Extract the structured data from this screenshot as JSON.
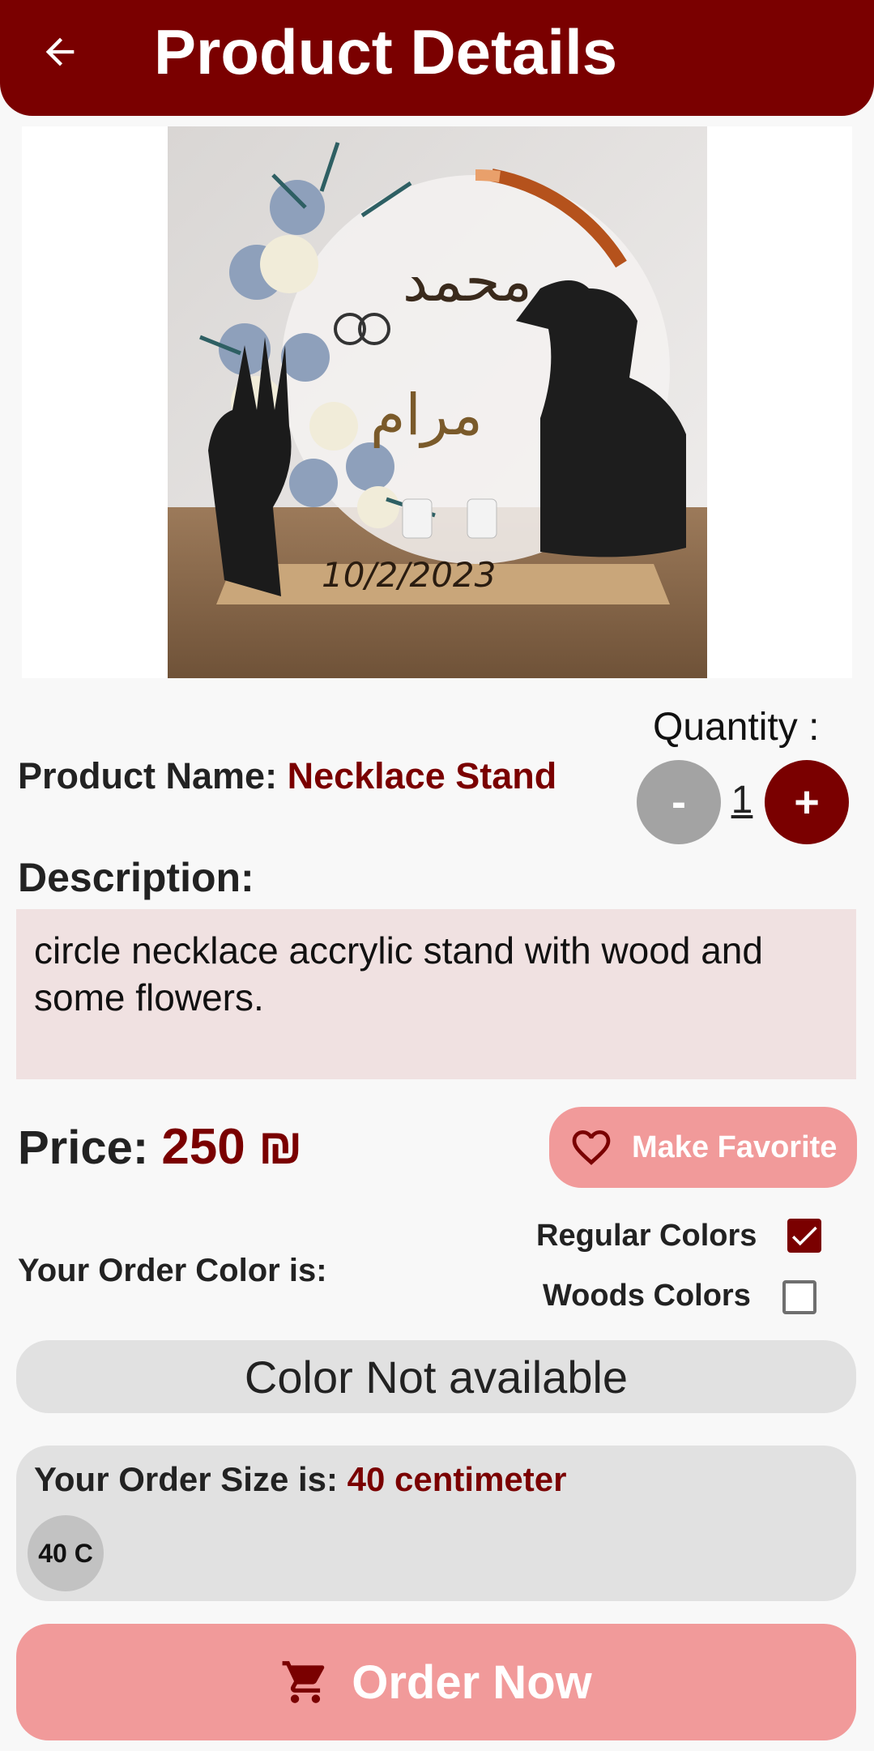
{
  "appbar": {
    "title": "Product Details",
    "back_icon": "arrow-left-icon"
  },
  "product": {
    "name_label": "Product Name:",
    "name": "Necklace Stand",
    "description_label": "Description:",
    "description": "circle necklace accrylic stand with wood and some flowers.",
    "price_label": "Price:",
    "price": "250",
    "currency": "₪",
    "photo_text": {
      "date": "10/2/2023",
      "names_top": "محمد",
      "names_bottom": "مرام"
    }
  },
  "quantity": {
    "label": "Quantity :",
    "minus": "-",
    "value": "1",
    "plus": "+"
  },
  "favorite": {
    "label": "Make Favorite",
    "icon": "heart-outline-icon"
  },
  "color": {
    "label": "Your Order Color is:",
    "options": [
      {
        "label": "Regular Colors",
        "checked": true
      },
      {
        "label": "Woods Colors",
        "checked": false
      }
    ],
    "availability": "Color Not available"
  },
  "size": {
    "label": "Your Order Size is:",
    "value": "40 centimeter",
    "chips": [
      "40 C"
    ]
  },
  "order": {
    "label": "Order Now",
    "icon": "cart-icon"
  },
  "colors": {
    "primary": "#7a0000",
    "button_pink": "#f19a9a",
    "desc_bg": "#f0e1e1",
    "panel_grey": "#e1e1e1"
  }
}
